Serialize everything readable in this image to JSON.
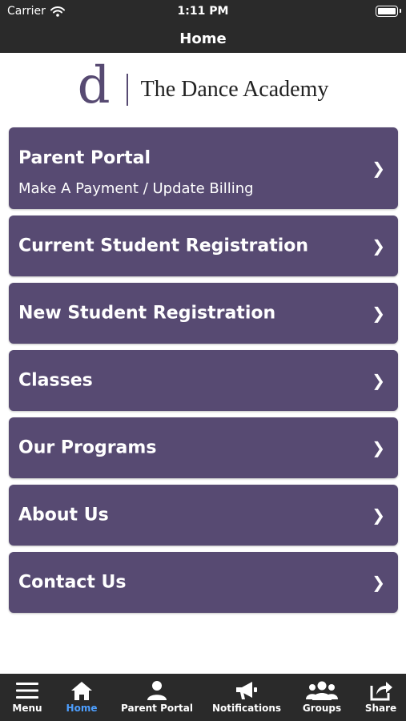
{
  "status_bar": {
    "carrier": "Carrier",
    "time": "1:11 PM"
  },
  "nav": {
    "title": "Home"
  },
  "logo": {
    "mark": "d",
    "name": "The Dance Academy"
  },
  "menu": {
    "items": [
      {
        "title": "Parent Portal",
        "subtitle": "Make A Payment / Update Billing",
        "chevron": "❯"
      },
      {
        "title": "Current Student Registration",
        "chevron": "❯"
      },
      {
        "title": "New Student Registration",
        "chevron": "❯"
      },
      {
        "title": "Classes",
        "chevron": "❯"
      },
      {
        "title": "Our Programs",
        "chevron": "❯"
      },
      {
        "title": "About Us",
        "chevron": "❯"
      },
      {
        "title": "Contact Us",
        "chevron": "❯"
      }
    ]
  },
  "tab_bar": {
    "tabs": [
      {
        "label": "Menu",
        "icon": "hamburger-icon",
        "active": false
      },
      {
        "label": "Home",
        "icon": "home-icon",
        "active": true
      },
      {
        "label": "Parent Portal",
        "icon": "person-icon",
        "active": false
      },
      {
        "label": "Notifications",
        "icon": "megaphone-icon",
        "active": false
      },
      {
        "label": "Groups",
        "icon": "group-icon",
        "active": false
      },
      {
        "label": "Share",
        "icon": "share-icon",
        "active": false
      }
    ]
  },
  "colors": {
    "accent": "#574a72",
    "bar": "#2a2a2a",
    "active_tab": "#4d9fff"
  }
}
